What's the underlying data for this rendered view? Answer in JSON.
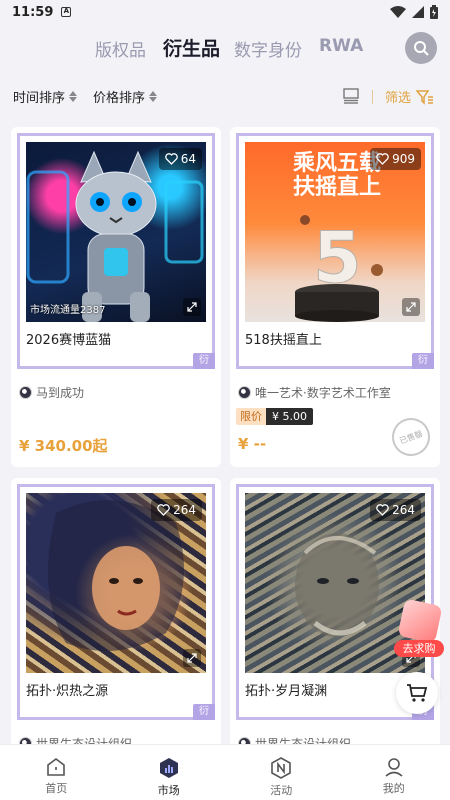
{
  "status": {
    "time": "11:59",
    "notice_glyph": "A"
  },
  "tabs": [
    {
      "label": "版权品",
      "active": false
    },
    {
      "label": "衍生品",
      "active": true
    },
    {
      "label": "数字身份",
      "active": false
    },
    {
      "label": "RWA",
      "active": false
    }
  ],
  "sort": {
    "time": "时间排序",
    "price": "价格排序",
    "filter": "筛选"
  },
  "colors": {
    "accent": "#e8a23c",
    "frame": "#c5b8ea",
    "tag": "#b3a4e6",
    "buy": "#ff4a4a"
  },
  "cards": [
    {
      "title": "2026赛博蓝猫",
      "likes": "64",
      "circulation": "市场流通量2387",
      "creator": "马到成功",
      "price": "¥ 340.00起",
      "derive_tag": "衍"
    },
    {
      "title": "518扶摇直上",
      "likes": "909",
      "poster_line1": "乘风五载",
      "poster_line2": "扶摇直上",
      "poster_number": "5",
      "creator": "唯一艺术·数字艺术工作室",
      "limit_label": "限价",
      "limit_price": "¥ 5.00",
      "price": "¥ --",
      "stamp": "已售罄",
      "derive_tag": "衍"
    },
    {
      "title": "拓扑·炽热之源",
      "likes": "264",
      "creator": "世界生态设计组织",
      "derive_tag": "衍"
    },
    {
      "title": "拓扑·岁月凝渊",
      "likes": "264",
      "creator": "世界生态设计组织",
      "derive_tag": "衍"
    }
  ],
  "floating": {
    "buy_label": "去求购"
  },
  "nav": [
    {
      "label": "首页",
      "icon": "home-icon"
    },
    {
      "label": "市场",
      "icon": "market-icon"
    },
    {
      "label": "活动",
      "icon": "activity-icon"
    },
    {
      "label": "我的",
      "icon": "profile-icon"
    }
  ]
}
